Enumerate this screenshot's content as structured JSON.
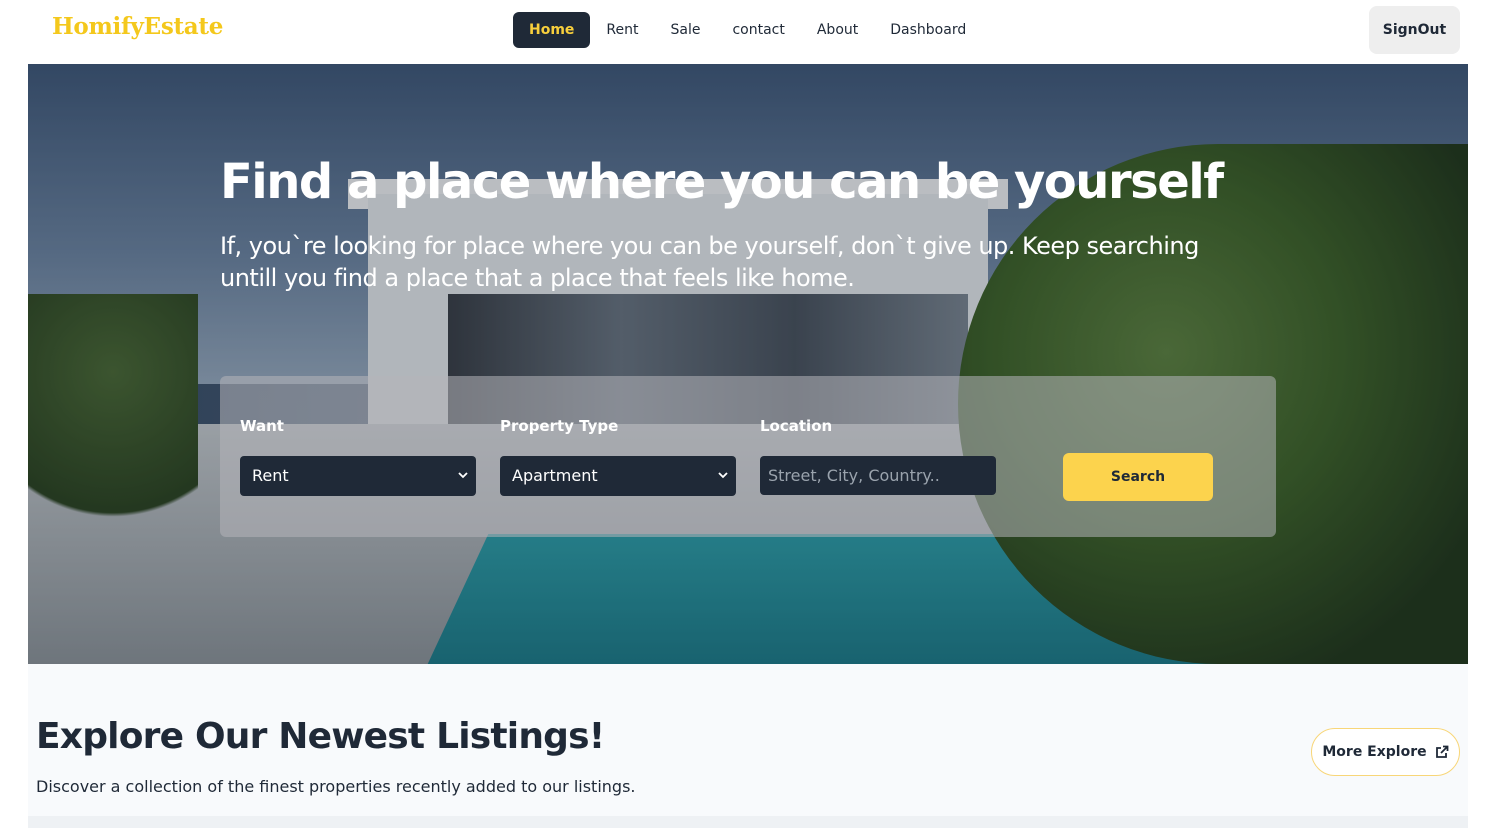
{
  "navbar": {
    "brand": "HomifyEstate",
    "links": [
      {
        "label": "Home",
        "active": true
      },
      {
        "label": "Rent",
        "active": false
      },
      {
        "label": "Sale",
        "active": false
      },
      {
        "label": "contact",
        "active": false
      },
      {
        "label": "About",
        "active": false
      },
      {
        "label": "Dashboard",
        "active": false
      }
    ],
    "signout_label": "SignOut"
  },
  "hero": {
    "title": "Find a place where you can be yourself",
    "subtitle": "If, you`re looking for place where you can be yourself, don`t give up. Keep searching untill you find a place that a place that feels like home.",
    "search": {
      "want_label": "Want",
      "want_value": "Rent",
      "type_label": "Property Type",
      "type_value": "Apartment",
      "location_label": "Location",
      "location_placeholder": "Street, City, Country..",
      "search_button": "Search"
    }
  },
  "listings": {
    "title": "Explore Our Newest Listings!",
    "subtitle": "Discover a collection of the finest properties recently added to our listings.",
    "more_button": "More Explore"
  },
  "colors": {
    "brand": "#f4c81c",
    "dark": "#1f2937",
    "accent": "#fcd34d"
  },
  "icons": {
    "select_chevron": "chevron-down-icon",
    "more_explore": "external-link-icon"
  }
}
